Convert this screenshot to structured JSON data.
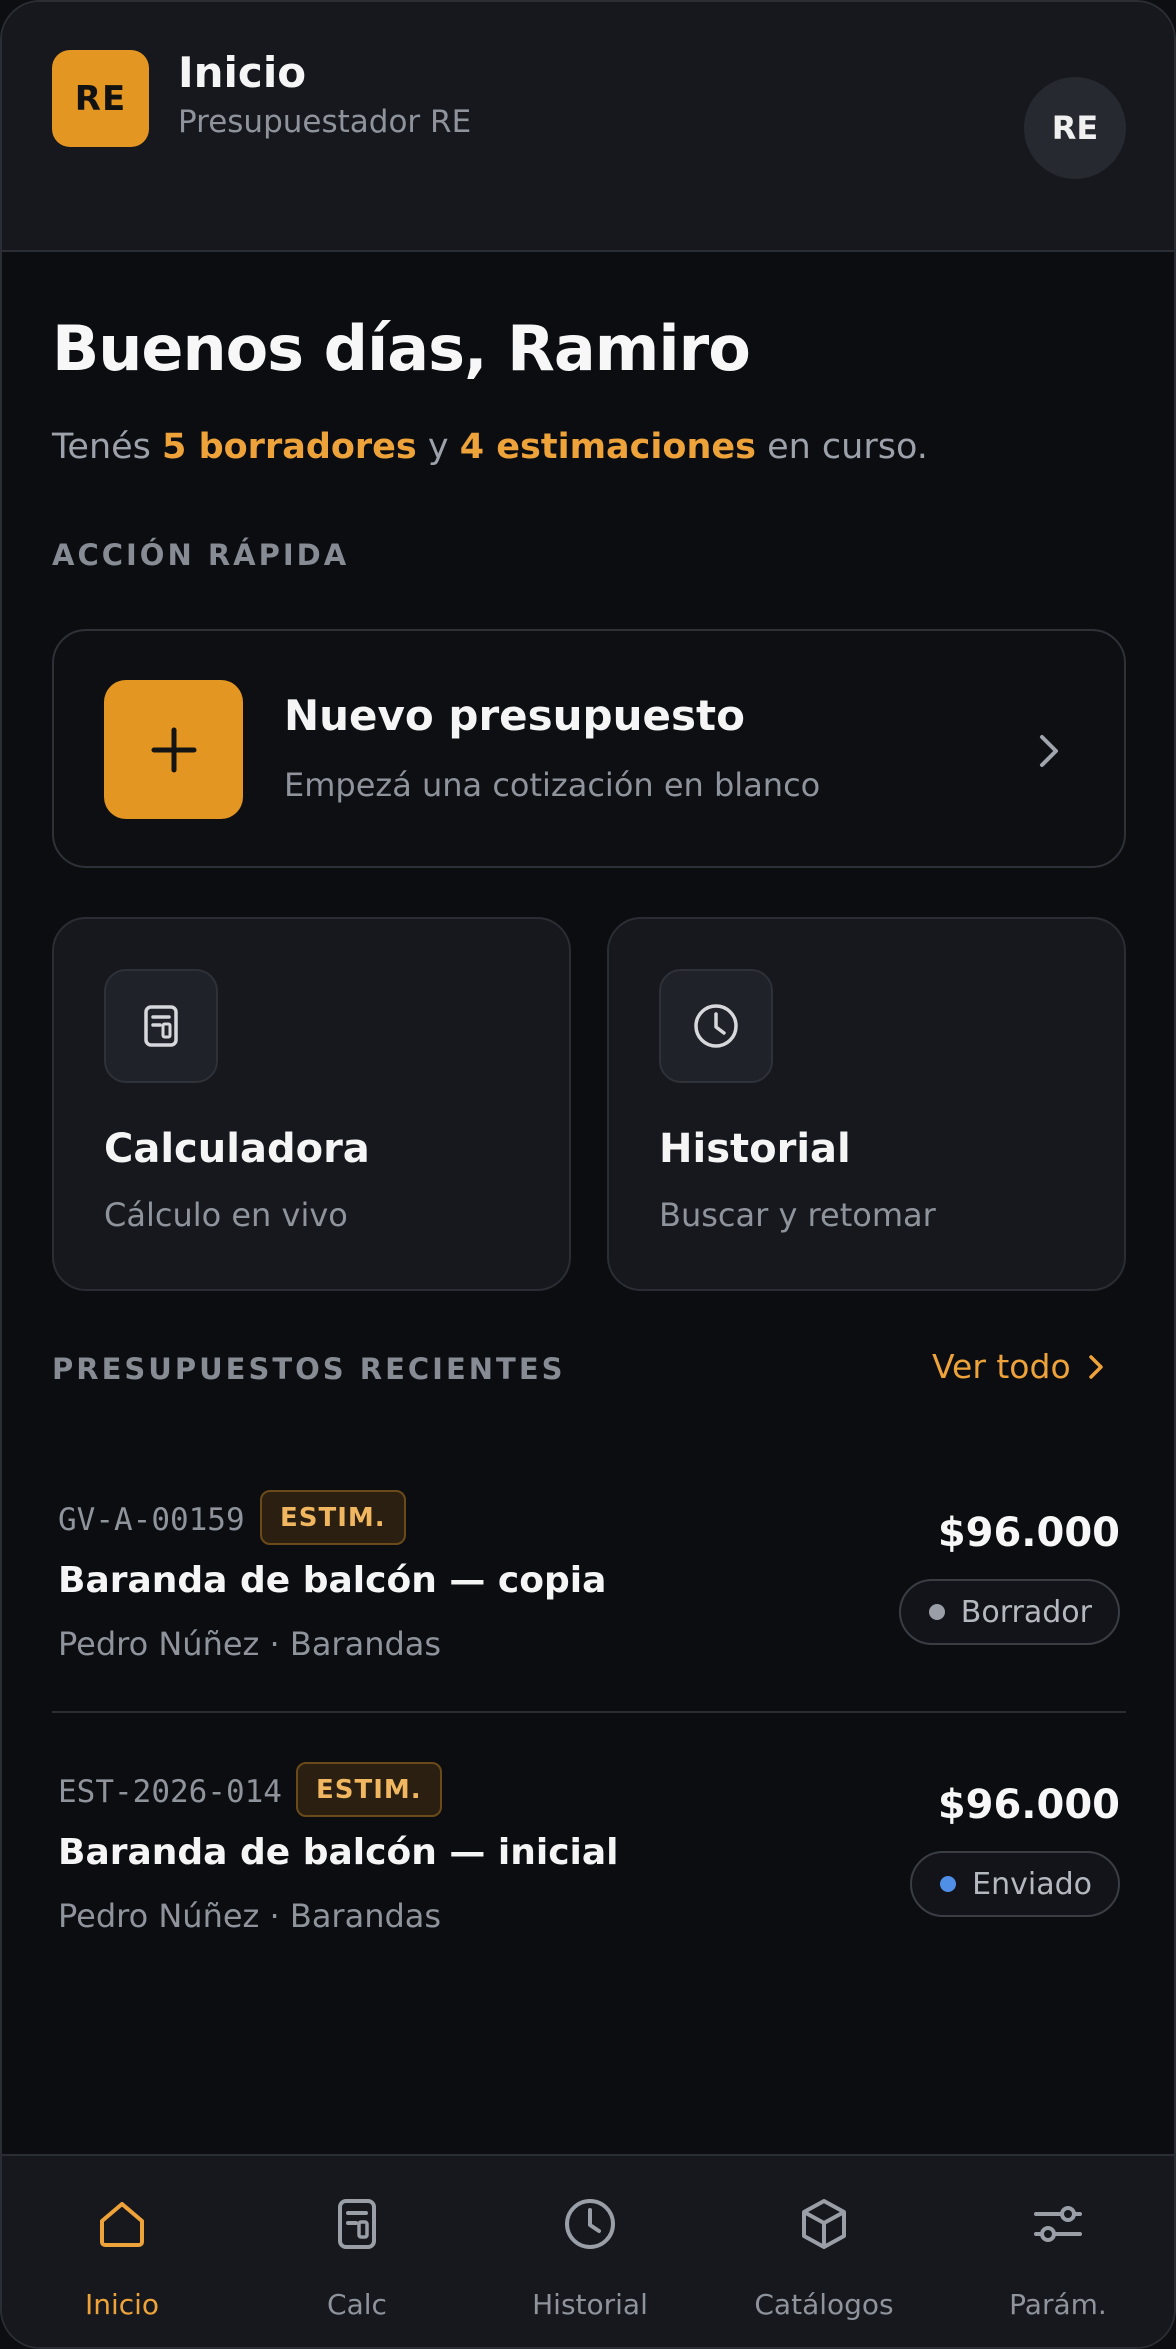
{
  "header": {
    "logo_text": "RE",
    "title": "Inicio",
    "subtitle": "Presupuestador RE",
    "avatar_initials": "RE"
  },
  "greeting": {
    "title": "Buenos días, Ramiro",
    "summary_prefix": "Tenés ",
    "drafts": "5 borradores",
    "connector": " y ",
    "estimates": "4 estimaciones",
    "summary_suffix": " en curso."
  },
  "quick_action": {
    "section_label": "ACCIÓN RÁPIDA",
    "new_quote": {
      "title": "Nuevo presupuesto",
      "subtitle": "Empezá una cotización en blanco"
    },
    "tiles": [
      {
        "title": "Calculadora",
        "subtitle": "Cálculo en vivo",
        "icon": "calculator-icon"
      },
      {
        "title": "Historial",
        "subtitle": "Buscar y retomar",
        "icon": "clock-icon"
      }
    ]
  },
  "recent": {
    "section_label": "PRESUPUESTOS RECIENTES",
    "see_all": "Ver todo",
    "items": [
      {
        "code": "GV-A-00159",
        "badge": "ESTIM.",
        "title": "Baranda de balcón — copia",
        "meta": "Pedro Núñez · Barandas",
        "amount": "$96.000",
        "status": "Borrador",
        "status_color": "#9a9ea6"
      },
      {
        "code": "EST-2026-014",
        "badge": "ESTIM.",
        "title": "Baranda de balcón — inicial",
        "meta": "Pedro Núñez · Barandas",
        "amount": "$96.000",
        "status": "Enviado",
        "status_color": "#4f8fe8"
      }
    ]
  },
  "nav": {
    "active": "Inicio",
    "accent_color": "#eea23a",
    "items": [
      {
        "label": "Inicio",
        "icon": "home-icon"
      },
      {
        "label": "Calc",
        "icon": "calculator-icon"
      },
      {
        "label": "Historial",
        "icon": "clock-icon"
      },
      {
        "label": "Catálogos",
        "icon": "box-icon"
      },
      {
        "label": "Parám.",
        "icon": "sliders-icon"
      }
    ]
  }
}
